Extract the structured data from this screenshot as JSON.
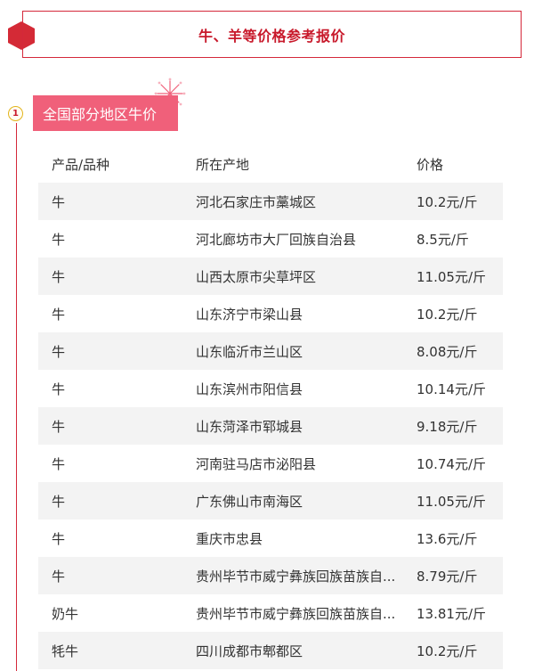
{
  "header": {
    "title": "牛、羊等价格参考报价"
  },
  "section": {
    "step_number": "1",
    "title": "全国部分地区牛价"
  },
  "table": {
    "columns": [
      "产品/品种",
      "所在产地",
      "价格"
    ],
    "rows": [
      {
        "product": "牛",
        "origin": "河北石家庄市藁城区",
        "price": "10.2元/斤"
      },
      {
        "product": "牛",
        "origin": "河北廊坊市大厂回族自治县",
        "price": "8.5元/斤"
      },
      {
        "product": "牛",
        "origin": "山西太原市尖草坪区",
        "price": "11.05元/斤"
      },
      {
        "product": "牛",
        "origin": "山东济宁市梁山县",
        "price": "10.2元/斤"
      },
      {
        "product": "牛",
        "origin": "山东临沂市兰山区",
        "price": "8.08元/斤"
      },
      {
        "product": "牛",
        "origin": "山东滨州市阳信县",
        "price": "10.14元/斤"
      },
      {
        "product": "牛",
        "origin": "山东菏泽市郓城县",
        "price": "9.18元/斤"
      },
      {
        "product": "牛",
        "origin": "河南驻马店市泌阳县",
        "price": "10.74元/斤"
      },
      {
        "product": "牛",
        "origin": "广东佛山市南海区",
        "price": "11.05元/斤"
      },
      {
        "product": "牛",
        "origin": "重庆市忠县",
        "price": "13.6元/斤"
      },
      {
        "product": "牛",
        "origin": "贵州毕节市威宁彝族回族苗族自...",
        "price": "8.79元/斤"
      },
      {
        "product": "奶牛",
        "origin": "贵州毕节市威宁彝族回族苗族自...",
        "price": "13.81元/斤"
      },
      {
        "product": "牦牛",
        "origin": "四川成都市郫都区",
        "price": "10.2元/斤"
      }
    ]
  },
  "colors": {
    "accent_red": "#d4283a",
    "section_pink": "#f0607a",
    "row_shade": "#f3f3f3"
  }
}
